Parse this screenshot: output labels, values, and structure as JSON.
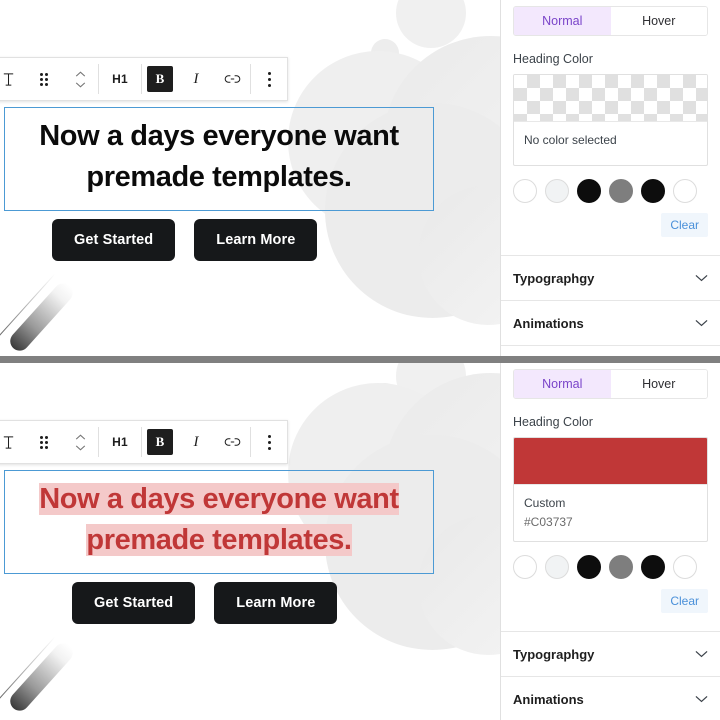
{
  "colors": {
    "accent_purple": "#7a44c9",
    "tab_active_bg": "#f3e8fd",
    "selection_border": "#4c9ad4",
    "custom_red": "#C03737",
    "cta_dark": "#16181a",
    "clear_link": "#4a90d9",
    "highlight_pink": "#f4c9c9"
  },
  "toolbar": {
    "paragraph_icon": "heading-type-icon",
    "drag_icon": "drag-handle-icon",
    "move_icon": "move-up-down-icon",
    "h1_label": "H1",
    "bold_label": "B",
    "italic_label": "I",
    "link_icon": "link-icon",
    "more_icon": "more-options-icon"
  },
  "canvas": {
    "heading_line1": "Now a days everyone want",
    "heading_line2": "premade templates.",
    "cta_primary": "Get Started",
    "cta_secondary": "Learn More"
  },
  "panel_top": {
    "tabs": [
      {
        "label": "Normal",
        "active": true
      },
      {
        "label": "Hover",
        "active": false
      }
    ],
    "field_label": "Heading Color",
    "swatch_state": "transparent-checkerboard",
    "caption_primary": "No color selected",
    "caption_secondary": "",
    "palette": [
      {
        "name": "white",
        "hex": "#ffffff"
      },
      {
        "name": "light-gray",
        "hex": "#f1f3f4"
      },
      {
        "name": "black",
        "hex": "#0d0d0d"
      },
      {
        "name": "gray",
        "hex": "#7e7e7e"
      },
      {
        "name": "black-2",
        "hex": "#0d0d0d"
      },
      {
        "name": "white-2",
        "hex": "#ffffff"
      }
    ],
    "clear_label": "Clear",
    "sections": [
      {
        "label": "Typographgy",
        "icon": "chevron-down-icon"
      },
      {
        "label": "Animations",
        "icon": "chevron-down-icon"
      }
    ]
  },
  "panel_bottom": {
    "tabs": [
      {
        "label": "Normal",
        "active": true
      },
      {
        "label": "Hover",
        "active": false
      }
    ],
    "field_label": "Heading Color",
    "swatch_state": "solid-color",
    "swatch_hex": "#C03737",
    "caption_primary": "Custom",
    "caption_secondary": "#C03737",
    "palette": [
      {
        "name": "white",
        "hex": "#ffffff"
      },
      {
        "name": "light-gray",
        "hex": "#f1f3f4"
      },
      {
        "name": "black",
        "hex": "#0d0d0d"
      },
      {
        "name": "gray",
        "hex": "#7e7e7e"
      },
      {
        "name": "black-2",
        "hex": "#0d0d0d"
      },
      {
        "name": "white-2",
        "hex": "#ffffff"
      }
    ],
    "clear_label": "Clear",
    "sections": [
      {
        "label": "Typographgy",
        "icon": "chevron-down-icon"
      },
      {
        "label": "Animations",
        "icon": "chevron-down-icon"
      }
    ]
  }
}
